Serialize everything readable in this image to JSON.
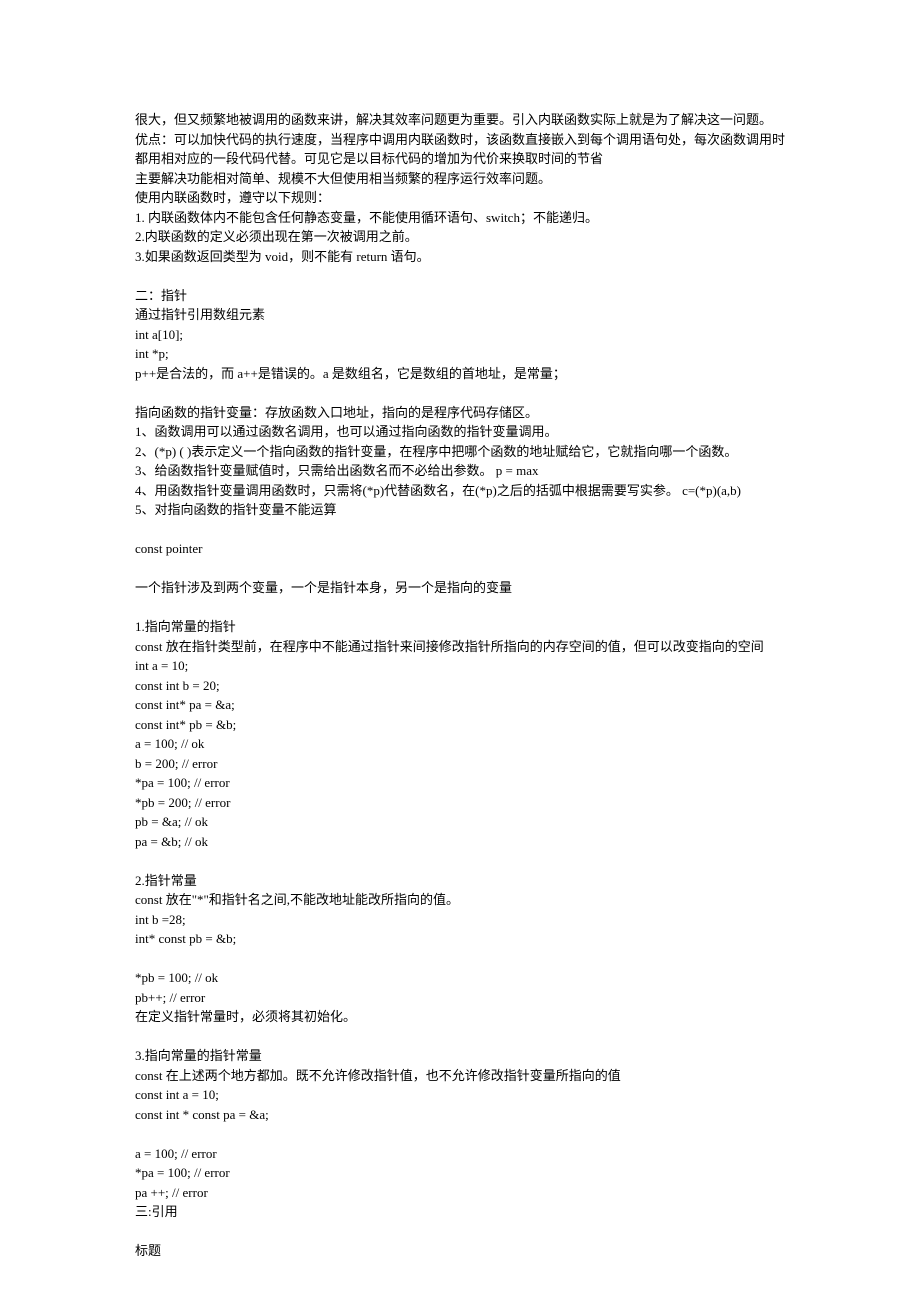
{
  "paragraphs": [
    {
      "text": "很大，但又频繁地被调用的函数来讲，解决其效率问题更为重要。引入内联函数实际上就是为了解决这一问题。"
    },
    {
      "text": "优点：可以加快代码的执行速度，当程序中调用内联函数时，该函数直接嵌入到每个调用语句处，每次函数调用时都用相对应的一段代码代替。可见它是以目标代码的增加为代价来换取时间的节省"
    },
    {
      "text": "主要解决功能相对简单、规模不大但使用相当频繁的程序运行效率问题。"
    },
    {
      "text": "使用内联函数时，遵守以下规则："
    },
    {
      "text": "1. 内联函数体内不能包含任何静态变量，不能使用循环语句、switch；不能递归。"
    },
    {
      "text": "2.内联函数的定义必须出现在第一次被调用之前。"
    },
    {
      "text": "3.如果函数返回类型为 void，则不能有 return 语句。"
    },
    {
      "blank": true
    },
    {
      "text": "二：指针"
    },
    {
      "text": "通过指针引用数组元素"
    },
    {
      "text": "int a[10];"
    },
    {
      "text": "int *p;"
    },
    {
      "text": "p++是合法的，而 a++是错误的。a 是数组名，它是数组的首地址，是常量；"
    },
    {
      "blank": true
    },
    {
      "text": "指向函数的指针变量：存放函数入口地址，指向的是程序代码存储区。"
    },
    {
      "text": "1、函数调用可以通过函数名调用，也可以通过指向函数的指针变量调用。"
    },
    {
      "text": "2、(*p) ( )表示定义一个指向函数的指针变量，在程序中把哪个函数的地址赋给它，它就指向哪一个函数。"
    },
    {
      "text": "3、给函数指针变量赋值时，只需给出函数名而不必给出参数。  p = max"
    },
    {
      "text": "4、用函数指针变量调用函数时，只需将(*p)代替函数名，在(*p)之后的括弧中根据需要写实参。 c=(*p)(a,b)"
    },
    {
      "text": "5、对指向函数的指针变量不能运算"
    },
    {
      "blank": true
    },
    {
      "text": "const pointer"
    },
    {
      "blank": true
    },
    {
      "text": "一个指针涉及到两个变量，一个是指针本身，另一个是指向的变量"
    },
    {
      "blank": true
    },
    {
      "text": "1.指向常量的指针"
    },
    {
      "text": "const 放在指针类型前，在程序中不能通过指针来间接修改指针所指向的内存空间的值，但可以改变指向的空间"
    },
    {
      "text": "int a = 10;"
    },
    {
      "text": "const int b = 20;"
    },
    {
      "text": "const int* pa = &a;"
    },
    {
      "text": "const int* pb = &b;"
    },
    {
      "text": "a = 100; // ok"
    },
    {
      "text": "b = 200; // error"
    },
    {
      "text": "*pa = 100; // error"
    },
    {
      "text": "*pb = 200; // error"
    },
    {
      "text": "pb = &a; // ok"
    },
    {
      "text": "pa = &b; // ok"
    },
    {
      "blank": true
    },
    {
      "text": "2.指针常量"
    },
    {
      "text": "const 放在\"*\"和指针名之间,不能改地址能改所指向的值。"
    },
    {
      "text": "int b =28;"
    },
    {
      "text": "int* const pb = &b;"
    },
    {
      "blank": true
    },
    {
      "text": "*pb = 100; // ok"
    },
    {
      "text": "pb++; // error"
    },
    {
      "text": "在定义指针常量时，必须将其初始化。"
    },
    {
      "blank": true
    },
    {
      "text": "3.指向常量的指针常量"
    },
    {
      "text": "const 在上述两个地方都加。既不允许修改指针值，也不允许修改指针变量所指向的值"
    },
    {
      "text": "const int a = 10;"
    },
    {
      "text": "const int * const pa = &a;"
    },
    {
      "blank": true
    },
    {
      "text": "a = 100; // error"
    },
    {
      "text": "*pa = 100; // error"
    },
    {
      "text": "pa ++; // error"
    },
    {
      "text": "三:引用"
    },
    {
      "blank": true
    },
    {
      "text": "标题"
    }
  ]
}
